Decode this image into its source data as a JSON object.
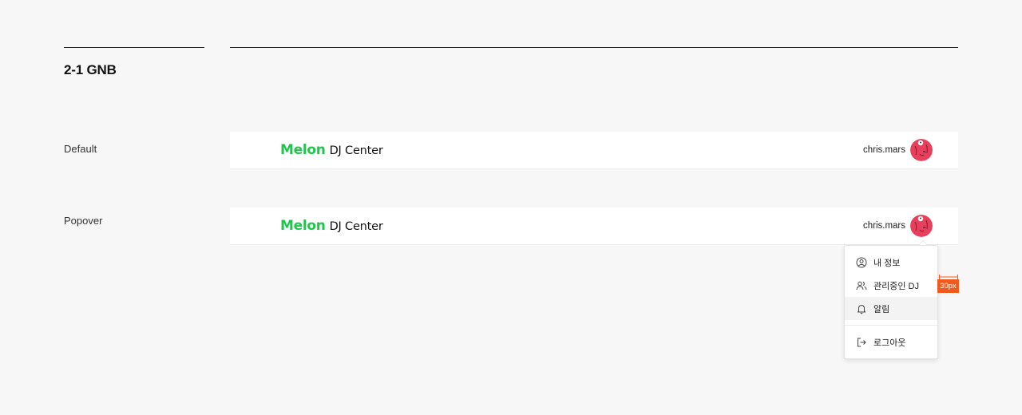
{
  "section": {
    "title": "2-1 GNB"
  },
  "rows": {
    "default_label": "Default",
    "popover_label": "Popover"
  },
  "gnb": {
    "logo_brand": "Melon",
    "logo_product": "DJ Center",
    "username": "chris.mars",
    "brand_color": "#1ec74a"
  },
  "popover": {
    "items": [
      {
        "label": "내 정보",
        "icon": "user-circle-icon"
      },
      {
        "label": "관리중인 DJ",
        "icon": "users-icon"
      },
      {
        "label": "알림",
        "icon": "bell-icon"
      },
      {
        "label": "로그아웃",
        "icon": "logout-icon"
      }
    ],
    "hovered_item": "알림"
  },
  "annotation": {
    "spacing_label": "30px",
    "color": "#f25a1d"
  }
}
